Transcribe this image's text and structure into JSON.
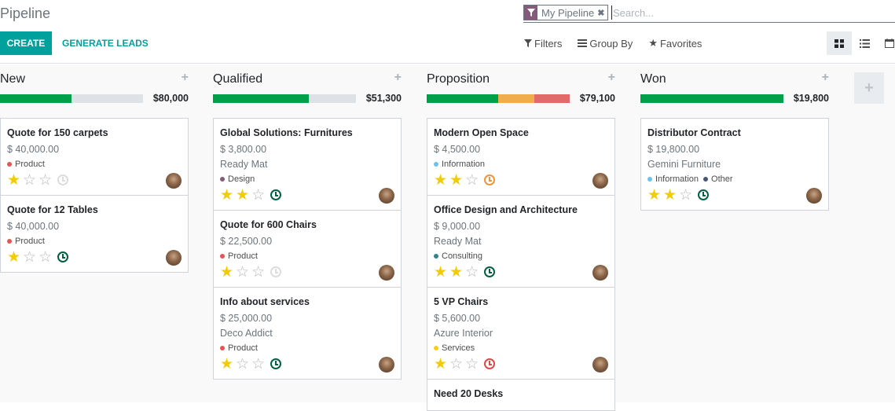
{
  "breadcrumb": "Pipeline",
  "search": {
    "facet_icon": "filter-icon",
    "facet_label": "My Pipeline",
    "facet_remove": "✖",
    "placeholder": "Search..."
  },
  "buttons": {
    "create": "CREATE",
    "generate_leads": "GENERATE LEADS"
  },
  "search_options": {
    "filters": "Filters",
    "group_by": "Group By",
    "favorites": "Favorites"
  },
  "views": [
    "kanban",
    "list",
    "calendar"
  ],
  "active_view": "kanban",
  "colors": {
    "primary": "#00a09d",
    "brand": "#875a7b",
    "progress_green": "#00a04a",
    "progress_orange": "#f0ad4e",
    "progress_red": "#e06c6a",
    "star_on": "#f3cc00",
    "activity_green": "#006241",
    "activity_orange": "#f0953c",
    "activity_red": "#e04747",
    "activity_none": "#dddddd"
  },
  "columns": [
    {
      "title": "New",
      "total": "$80,000",
      "add": "+",
      "progress": [
        {
          "color": "green",
          "fraction": 0.5
        }
      ],
      "cards": [
        {
          "title": "Quote for 150 carpets",
          "amount": "$ 40,000.00",
          "partner": "",
          "tags": [
            {
              "label": "Product",
              "color": "#e65454"
            }
          ],
          "stars": 1,
          "activity": "none"
        },
        {
          "title": "Quote for 12 Tables",
          "amount": "$ 40,000.00",
          "partner": "",
          "tags": [
            {
              "label": "Product",
              "color": "#e65454"
            }
          ],
          "stars": 1,
          "activity": "green"
        }
      ]
    },
    {
      "title": "Qualified",
      "total": "$51,300",
      "add": "+",
      "progress": [
        {
          "color": "green",
          "fraction": 0.67
        }
      ],
      "cards": [
        {
          "title": "Global Solutions: Furnitures",
          "amount": "$ 3,800.00",
          "partner": "Ready Mat",
          "tags": [
            {
              "label": "Design",
              "color": "#875a7b"
            }
          ],
          "stars": 2,
          "activity": "green"
        },
        {
          "title": "Quote for 600 Chairs",
          "amount": "$ 22,500.00",
          "partner": "",
          "tags": [
            {
              "label": "Product",
              "color": "#e65454"
            }
          ],
          "stars": 1,
          "activity": "none"
        },
        {
          "title": "Info about services",
          "amount": "$ 25,000.00",
          "partner": "Deco Addict",
          "tags": [
            {
              "label": "Product",
              "color": "#e65454"
            }
          ],
          "stars": 1,
          "activity": "green"
        }
      ]
    },
    {
      "title": "Proposition",
      "total": "$79,100",
      "add": "+",
      "progress": [
        {
          "color": "green",
          "fraction": 0.5
        },
        {
          "color": "orange",
          "fraction": 0.25
        },
        {
          "color": "red",
          "fraction": 0.25
        }
      ],
      "cards": [
        {
          "title": "Modern Open Space",
          "amount": "$ 4,500.00",
          "partner": "",
          "tags": [
            {
              "label": "Information",
              "color": "#6cc1ed"
            }
          ],
          "stars": 2,
          "activity": "orange"
        },
        {
          "title": "Office Design and Architecture",
          "amount": "$ 9,000.00",
          "partner": "Ready Mat",
          "tags": [
            {
              "label": "Consulting",
              "color": "#30838f"
            }
          ],
          "stars": 2,
          "activity": "green"
        },
        {
          "title": "5 VP Chairs",
          "amount": "$ 5,600.00",
          "partner": "Azure Interior",
          "tags": [
            {
              "label": "Services",
              "color": "#f7cd1f"
            }
          ],
          "stars": 1,
          "activity": "red"
        },
        {
          "title": "Need 20 Desks",
          "amount": "",
          "partner": "",
          "tags": [],
          "stars": null,
          "activity": null
        }
      ]
    },
    {
      "title": "Won",
      "total": "$19,800",
      "add": "+",
      "progress": [
        {
          "color": "green",
          "fraction": 1.0
        }
      ],
      "cards": [
        {
          "title": "Distributor Contract",
          "amount": "$ 19,800.00",
          "partner": "Gemini Furniture",
          "tags": [
            {
              "label": "Information",
              "color": "#6cc1ed"
            },
            {
              "label": "Other",
              "color": "#475577"
            }
          ],
          "stars": 2,
          "activity": "green"
        }
      ]
    }
  ],
  "add_column": "+"
}
